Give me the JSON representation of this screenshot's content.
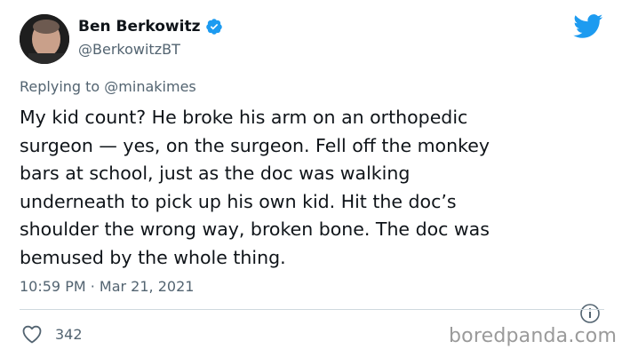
{
  "author": {
    "display_name": "Ben Berkowitz",
    "handle": "@BerkowitzBT",
    "verified": true
  },
  "reply": {
    "prefix": "Replying to",
    "mention": "@minakimes"
  },
  "tweet": {
    "lines": [
      "My kid count? He broke his arm on an orthopedic",
      "surgeon — yes, on the surgeon. Fell off the monkey",
      "bars at school, just as the doc was walking",
      "underneath to pick up his own kid. Hit the doc’s",
      "shoulder the wrong way, broken bone. The doc was",
      "bemused by the whole thing."
    ],
    "timestamp": "10:59 PM · Mar 21, 2021"
  },
  "engagement": {
    "likes": "342"
  },
  "watermark": "boredpanda.com",
  "colors": {
    "twitter_blue": "#1d9bf0",
    "text_primary": "#0f1419",
    "text_secondary": "#536471"
  },
  "icons": {
    "brand": "twitter-bird-icon",
    "verified": "verified-badge-icon",
    "info": "info-icon",
    "like": "heart-icon"
  }
}
